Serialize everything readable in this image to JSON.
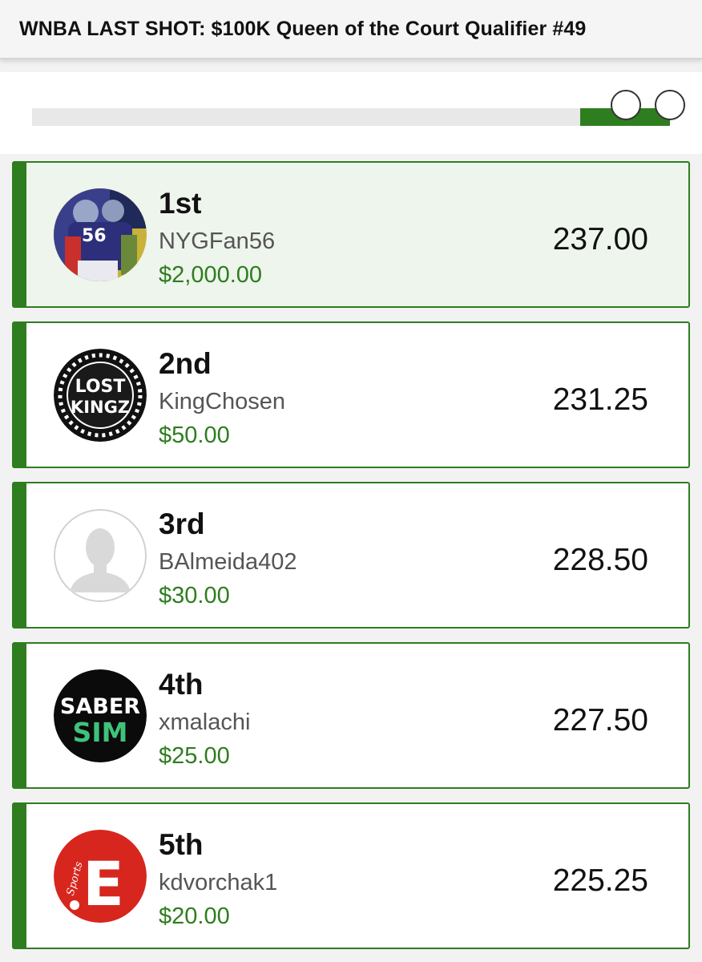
{
  "header": {
    "title": "WNBA LAST SHOT: $100K Queen of the Court Qualifier #49"
  },
  "colors": {
    "accent": "#2e7d1f",
    "highlight_bg": "#eef5ec"
  },
  "avatars": {
    "card2_logo_line1": "LOST",
    "card2_logo_line2": "KINGZ",
    "card4_logo_line1": "SABER",
    "card4_logo_line2": "SIM",
    "card5_logo_letter": "E",
    "card5_logo_word": "Sports",
    "card1_jersey_number": "56"
  },
  "leaderboard": [
    {
      "rank": "1st",
      "username": "NYGFan56",
      "prize": "$2,000.00",
      "score": "237.00",
      "avatar": "football-player-photo"
    },
    {
      "rank": "2nd",
      "username": "KingChosen",
      "prize": "$50.00",
      "score": "231.25",
      "avatar": "lost-kingz-logo"
    },
    {
      "rank": "3rd",
      "username": "BAlmeida402",
      "prize": "$30.00",
      "score": "228.50",
      "avatar": "default-user-silhouette"
    },
    {
      "rank": "4th",
      "username": "xmalachi",
      "prize": "$25.00",
      "score": "227.50",
      "avatar": "sabersim-logo"
    },
    {
      "rank": "5th",
      "username": "kdvorchak1",
      "prize": "$20.00",
      "score": "225.25",
      "avatar": "nbc-sports-e-logo"
    }
  ]
}
